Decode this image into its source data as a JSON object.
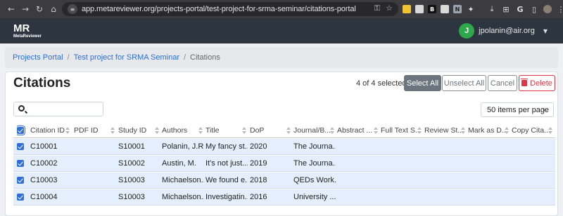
{
  "browser": {
    "url": "app.metareviewer.org/projects-portal/test-project-for-srma-seminar/citations-portal"
  },
  "navbar": {
    "brand_main": "MR",
    "brand_sub": "MetaReviewer",
    "user_initial": "J",
    "user_email": "jpolanin@air.org"
  },
  "breadcrumb": {
    "items": [
      "Projects Portal",
      "Test project for SRMA Seminar",
      "Citations"
    ]
  },
  "citations": {
    "title": "Citations",
    "selected_text": "4 of 4 selected",
    "select_all_label": "Select All",
    "unselect_all_label": "Unselect All",
    "cancel_label": "Cancel",
    "delete_label": "Delete",
    "search_value": "",
    "per_page": "50 items per page",
    "columns": [
      "Citation ID",
      "PDF ID",
      "Study ID",
      "Authors",
      "Title",
      "DoP",
      "Journal/B...",
      "Abstract ...",
      "Full Text S...",
      "Review St...",
      "Mark as D...",
      "Copy Cita..."
    ],
    "rows": [
      [
        "C10001",
        "",
        "S10001",
        "Polanin, J.R.",
        "My fancy st...",
        "2020",
        "The Journa...",
        "",
        "",
        "",
        "",
        ""
      ],
      [
        "C10002",
        "",
        "S10002",
        "Austin, M.",
        "It's not just...",
        "2019",
        "The Journa...",
        "",
        "",
        "",
        "",
        ""
      ],
      [
        "C10003",
        "",
        "S10003",
        "Michaelson...",
        "We found e...",
        "2018",
        "QEDs Work...",
        "",
        "",
        "",
        "",
        ""
      ],
      [
        "C10004",
        "",
        "S10003",
        "Michaelson...",
        "Investigatin...",
        "2016",
        "University ...",
        "",
        "",
        "",
        "",
        ""
      ]
    ]
  },
  "colors": {
    "navbar_bg": "#2d3540",
    "link": "#2b6fd6",
    "selected_row": "#e4eefc",
    "delete": "#dc3545",
    "avatar": "#2fa74b"
  }
}
